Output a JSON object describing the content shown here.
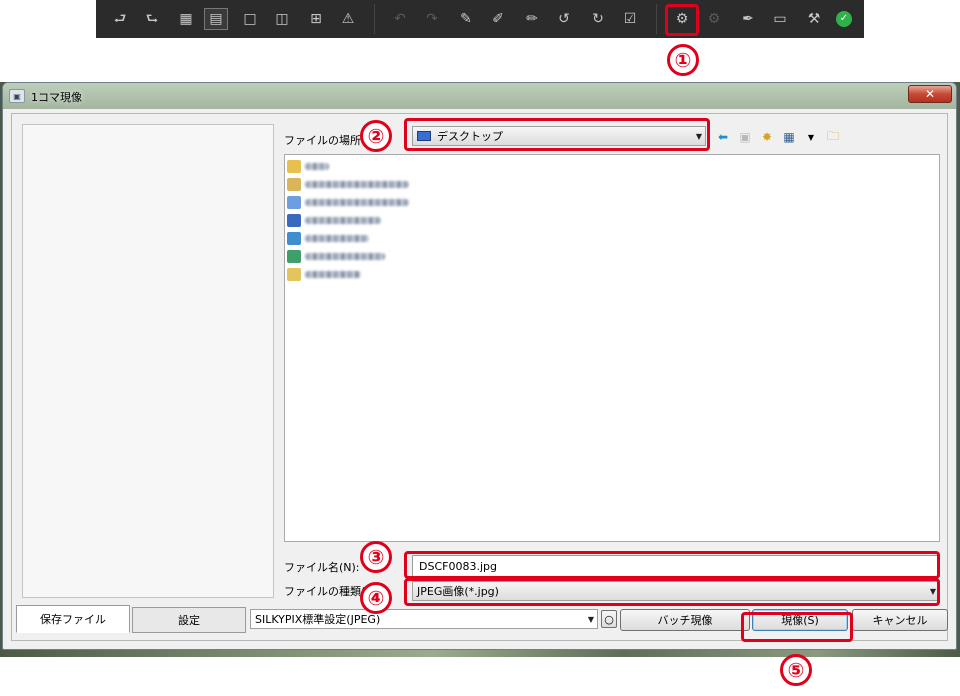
{
  "toolbar": {
    "icons": [
      "rotate-left-icon",
      "rotate-right-icon",
      "grid-view-icon",
      "split-view-icon",
      "single-view-icon",
      "compare-view-icon",
      "full-view-icon",
      "warning-icon",
      "undo-icon",
      "redo-icon",
      "paste-icon",
      "copy-params-icon",
      "edit-icon",
      "rotate-ccw-icon",
      "rotate-cw-icon",
      "check-icon",
      "develop-one-icon",
      "batch-develop-icon",
      "brush-icon",
      "display-icon",
      "hammer-icon",
      "ok-icon"
    ]
  },
  "callouts": [
    "①",
    "②",
    "③",
    "④",
    "⑤"
  ],
  "dialog": {
    "title": "1コマ現像",
    "close_label": "✕",
    "look_in_label": "ファイルの場所(I):",
    "look_in_value": "デスクトップ",
    "filename_label": "ファイル名(N):",
    "filename_value": "DSCF0083.jpg",
    "filetype_label": "ファイルの種類(T):",
    "filetype_value": "JPEG画像(*.jpg)",
    "tabs": [
      "保存ファイル",
      "設定"
    ],
    "preset_value": "SILKYPIX標準設定(JPEG)",
    "preset_option_button": "○",
    "batch_button": "バッチ現像",
    "develop_button": "現像(S)",
    "cancel_button": "キャンセル"
  },
  "colors": {
    "callout": "#e0001b",
    "toolbar_bg": "#2b2b2b",
    "dialog_bg": "#f0f0f0"
  }
}
